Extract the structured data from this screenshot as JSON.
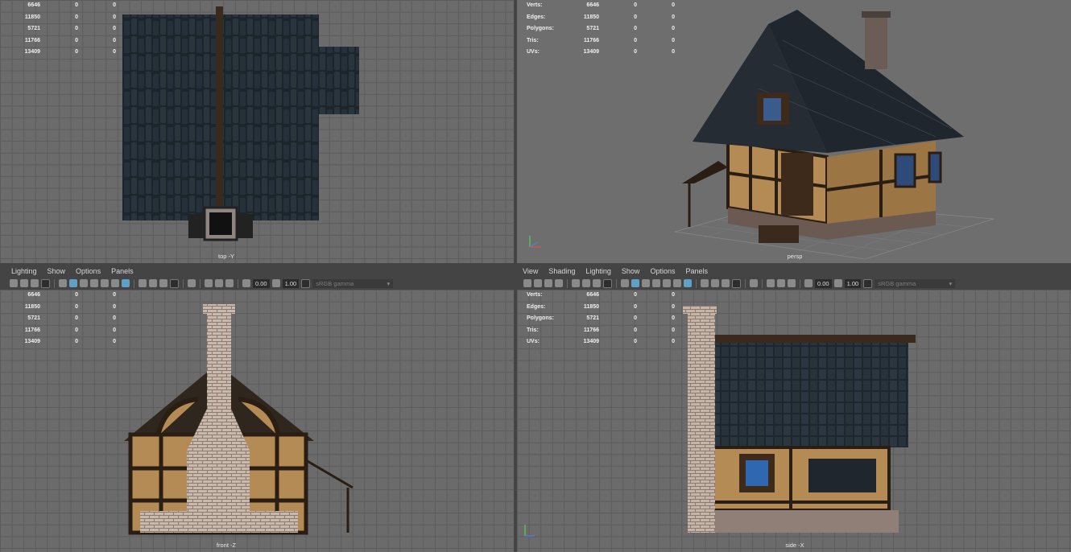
{
  "stats_labels": {
    "verts": "Verts:",
    "edges": "Edges:",
    "polygons": "Polygons:",
    "tris": "Tris:",
    "uvs": "UVs:"
  },
  "stats": {
    "verts": [
      "6646",
      "0",
      "0"
    ],
    "edges": [
      "11850",
      "0",
      "0"
    ],
    "polygons": [
      "5721",
      "0",
      "0"
    ],
    "tris": [
      "11766",
      "0",
      "0"
    ],
    "uvs": [
      "13409",
      "0",
      "0"
    ]
  },
  "viewports": {
    "top": "top -Y",
    "persp": "persp",
    "front": "front -Z",
    "side": "side -X"
  },
  "menu_left": {
    "lighting": "Lighting",
    "show": "Show",
    "options": "Options",
    "panels": "Panels"
  },
  "menu_right": {
    "view": "View",
    "shading": "Shading",
    "lighting": "Lighting",
    "show": "Show",
    "options": "Options",
    "panels": "Panels"
  },
  "toolbar": {
    "exposure": "0.00",
    "gamma_value": "1.00",
    "color_space": "sRGB gamma"
  },
  "icons": [
    "camera-icon",
    "grid-icon",
    "wireframe-icon",
    "smooth-shade-icon",
    "textured-icon",
    "light-icon",
    "shadow-icon",
    "isolate-icon",
    "xray-icon",
    "exposure-icon",
    "gamma-icon"
  ],
  "colors": {
    "viewport_bg": "#6b6b6b",
    "grid_line": "#5c5c5c",
    "ui_bg": "#444444",
    "selected_icon": "#5ea0c8"
  }
}
